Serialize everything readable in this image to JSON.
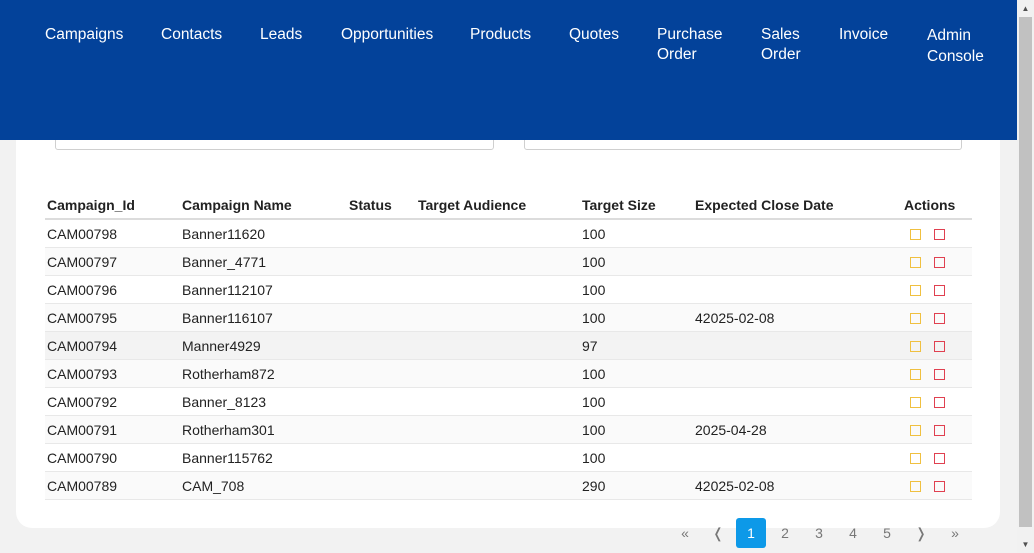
{
  "nav": {
    "campaigns": "Campaigns",
    "contacts": "Contacts",
    "leads": "Leads",
    "opportunities": "Opportunities",
    "products": "Products",
    "quotes": "Quotes",
    "purchase_order": [
      "Purchase",
      "Order"
    ],
    "sales_order": [
      "Sales",
      "Order"
    ],
    "invoice": "Invoice",
    "admin_console": [
      "Admin",
      "Console"
    ]
  },
  "table": {
    "headers": [
      "Campaign_Id",
      "Campaign Name",
      "Status",
      "Target Audience",
      "Target Size",
      "Expected Close Date",
      "Actions"
    ],
    "rows": [
      [
        "CAM00798",
        "Banner11620",
        "",
        "",
        "100",
        ""
      ],
      [
        "CAM00797",
        "Banner_4771",
        "",
        "",
        "100",
        ""
      ],
      [
        "CAM00796",
        "Banner112107",
        "",
        "",
        "100",
        ""
      ],
      [
        "CAM00795",
        "Banner116107",
        "",
        "",
        "100",
        "42025-02-08"
      ],
      [
        "CAM00794",
        "Manner4929",
        "",
        "",
        "97",
        ""
      ],
      [
        "CAM00793",
        "Rotherham872",
        "",
        "",
        "100",
        ""
      ],
      [
        "CAM00792",
        "Banner_8123",
        "",
        "",
        "100",
        ""
      ],
      [
        "CAM00791",
        "Rotherham301",
        "",
        "",
        "100",
        "2025-04-28"
      ],
      [
        "CAM00790",
        "Banner115762",
        "",
        "",
        "100",
        ""
      ],
      [
        "CAM00789",
        "CAM_708",
        "",
        "",
        "290",
        "42025-02-08"
      ]
    ]
  },
  "pagination": {
    "first": "«",
    "prev": "❬",
    "pages": [
      "1",
      "2",
      "3",
      "4",
      "5"
    ],
    "current": "1",
    "next": "❭",
    "last": "»"
  },
  "colors": {
    "nav_bg": "#03429a",
    "avatar_bg": "#7e3a5a",
    "active_page": "#0d99e8",
    "edit_icon": "#f0c040",
    "delete_icon": "#e04050"
  }
}
